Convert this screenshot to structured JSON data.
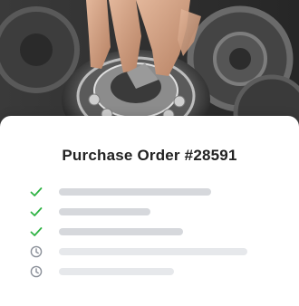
{
  "order": {
    "title": "Purchase Order #28591"
  },
  "colors": {
    "done": "#2fb344",
    "pending": "#8b9099",
    "bar_done": "#d6d8dc",
    "bar_pending": "#e6e8eb"
  },
  "steps": [
    {
      "status": "done",
      "icon": "check-icon"
    },
    {
      "status": "done",
      "icon": "check-icon"
    },
    {
      "status": "done",
      "icon": "check-icon"
    },
    {
      "status": "pending",
      "icon": "clock-icon"
    },
    {
      "status": "pending",
      "icon": "clock-icon"
    }
  ]
}
